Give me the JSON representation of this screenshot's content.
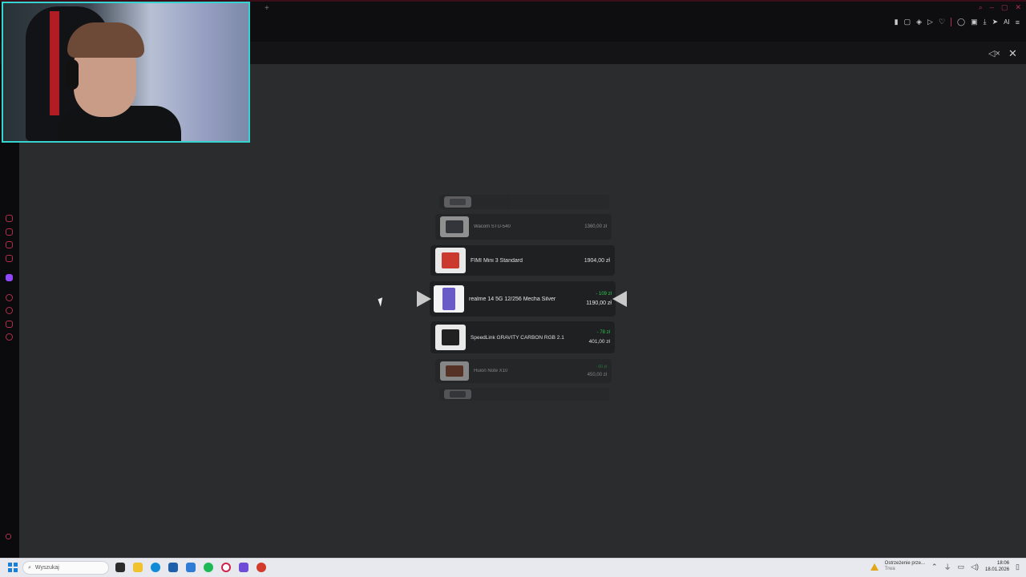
{
  "browser": {
    "toolbar_ai_label": "AI",
    "accent": "#b0314b"
  },
  "carousel": {
    "items": [
      {
        "name": "",
        "price": "",
        "delta": "",
        "color": "#7b7e83"
      },
      {
        "name": "Wacom STU-540",
        "price": "1360,00 zł",
        "delta": "",
        "color": "#3b3f47"
      },
      {
        "name": "FIMI Mini 3 Standard",
        "price": "1904,00 zł",
        "delta": "",
        "color": "#d43a2f"
      },
      {
        "name": "realme 14 5G 12/256 Mecha Silver",
        "price": "1190,00 zł",
        "delta": "- 109 zł",
        "color": "#6a5ac8"
      },
      {
        "name": "SpeedLink GRAVITY CARBON RGB 2.1",
        "price": "401,00 zł",
        "delta": "- 78 zł",
        "color": "#202020"
      },
      {
        "name": "Huion Note X10",
        "price": "450,00 zł",
        "delta": "- 60 zł",
        "color": "#8a3a1e"
      },
      {
        "name": "",
        "price": "",
        "delta": "",
        "color": "#555a60"
      }
    ]
  },
  "taskbar": {
    "search_placeholder": "Wyszukaj",
    "notification_title": "Ostrzeżenie prze...",
    "notification_sub": "Trwa",
    "time": "18:06",
    "date": "18.01.2026"
  }
}
